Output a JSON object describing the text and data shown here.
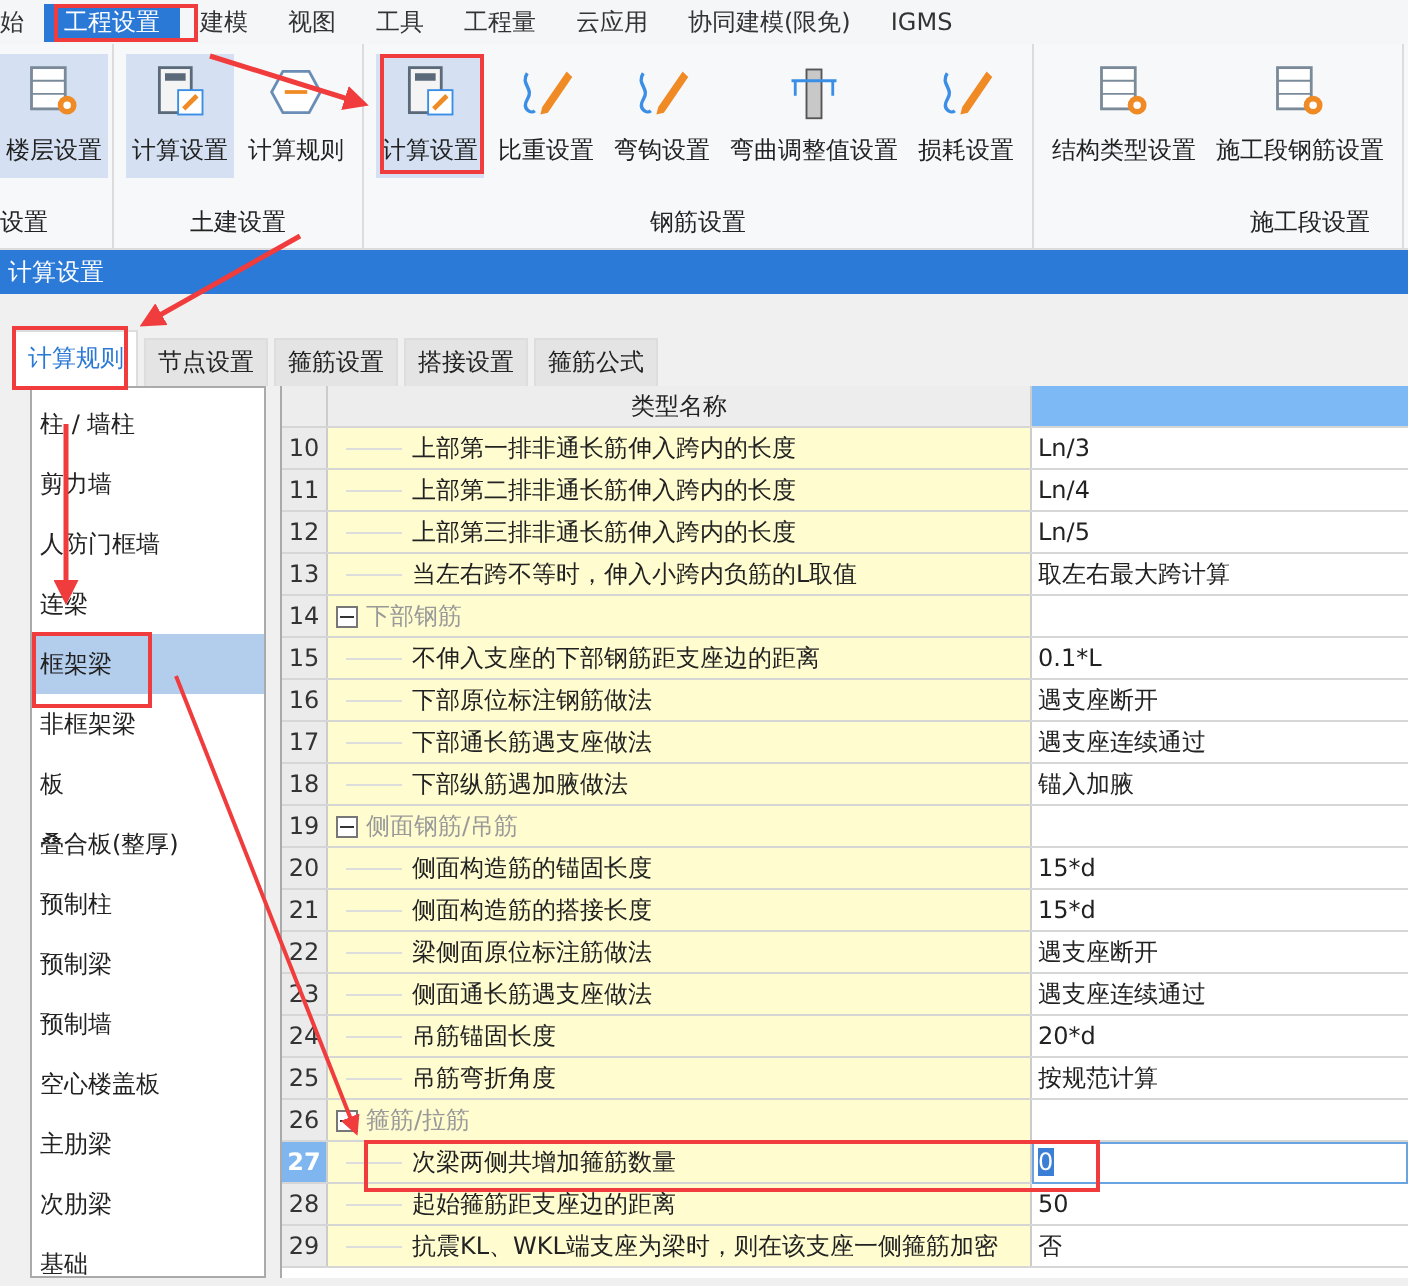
{
  "menu": [
    {
      "label": "始",
      "selected": false
    },
    {
      "label": "工程设置",
      "selected": true
    },
    {
      "label": "建模",
      "selected": false
    },
    {
      "label": "视图",
      "selected": false
    },
    {
      "label": "工具",
      "selected": false
    },
    {
      "label": "工程量",
      "selected": false
    },
    {
      "label": "云应用",
      "selected": false
    },
    {
      "label": "协同建模(限免)",
      "selected": false
    },
    {
      "label": "IGMS",
      "selected": false
    }
  ],
  "ribbon": [
    {
      "title": "设置",
      "buttons": [
        {
          "label": "楼层设置",
          "selected": true
        }
      ]
    },
    {
      "title": "土建设置",
      "buttons": [
        {
          "label": "计算设置",
          "selected": true
        },
        {
          "label": "计算规则",
          "selected": false
        }
      ]
    },
    {
      "title": "钢筋设置",
      "buttons": [
        {
          "label": "计算设置",
          "selected": true
        },
        {
          "label": "比重设置",
          "selected": false
        },
        {
          "label": "弯钩设置",
          "selected": false
        },
        {
          "label": "弯曲调整值设置",
          "selected": false
        },
        {
          "label": "损耗设置",
          "selected": false
        }
      ]
    },
    {
      "title": "施工段设置",
      "buttons": [
        {
          "label": "结构类型设置",
          "selected": false
        },
        {
          "label": "施工段钢筋设置",
          "selected": false
        }
      ]
    }
  ],
  "dialog": {
    "title": "计算设置"
  },
  "tabs": [
    {
      "label": "计算规则",
      "selected": true
    },
    {
      "label": "节点设置",
      "selected": false
    },
    {
      "label": "箍筋设置",
      "selected": false
    },
    {
      "label": "搭接设置",
      "selected": false
    },
    {
      "label": "箍筋公式",
      "selected": false
    }
  ],
  "sidebar": {
    "items": [
      {
        "label": "柱 / 墙柱",
        "selected": false
      },
      {
        "label": "剪力墙",
        "selected": false
      },
      {
        "label": "人防门框墙",
        "selected": false
      },
      {
        "label": "连梁",
        "selected": false
      },
      {
        "label": "框架梁",
        "selected": true
      },
      {
        "label": "非框架梁",
        "selected": false
      },
      {
        "label": "板",
        "selected": false
      },
      {
        "label": "叠合板(整厚)",
        "selected": false
      },
      {
        "label": "预制柱",
        "selected": false
      },
      {
        "label": "预制梁",
        "selected": false
      },
      {
        "label": "预制墙",
        "selected": false
      },
      {
        "label": "空心楼盖板",
        "selected": false
      },
      {
        "label": "主肋梁",
        "selected": false
      },
      {
        "label": "次肋梁",
        "selected": false
      },
      {
        "label": "基础",
        "selected": false
      }
    ]
  },
  "table": {
    "columns": [
      "类型名称"
    ],
    "rows": [
      {
        "kind": "item",
        "no": "10",
        "name": "上部第一排非通长筋伸入跨内的长度",
        "value": "Ln/3",
        "selected": false
      },
      {
        "kind": "item",
        "no": "11",
        "name": "上部第二排非通长筋伸入跨内的长度",
        "value": "Ln/4",
        "selected": false
      },
      {
        "kind": "item",
        "no": "12",
        "name": "上部第三排非通长筋伸入跨内的长度",
        "value": "Ln/5",
        "selected": false
      },
      {
        "kind": "item",
        "no": "13",
        "name": "当左右跨不等时，伸入小跨内负筋的L取值",
        "value": "取左右最大跨计算",
        "selected": false
      },
      {
        "kind": "group",
        "no": "14",
        "name": "下部钢筋",
        "expanded": true,
        "children": [
          {
            "kind": "item",
            "no": "15",
            "name": "不伸入支座的下部钢筋距支座边的距离",
            "value": "0.1*L",
            "selected": false
          },
          {
            "kind": "item",
            "no": "16",
            "name": "下部原位标注钢筋做法",
            "value": "遇支座断开",
            "selected": false
          },
          {
            "kind": "item",
            "no": "17",
            "name": "下部通长筋遇支座做法",
            "value": "遇支座连续通过",
            "selected": false
          },
          {
            "kind": "item",
            "no": "18",
            "name": "下部纵筋遇加腋做法",
            "value": "锚入加腋",
            "selected": false
          }
        ]
      },
      {
        "kind": "group",
        "no": "19",
        "name": "侧面钢筋/吊筋",
        "expanded": true,
        "children": [
          {
            "kind": "item",
            "no": "20",
            "name": "侧面构造筋的锚固长度",
            "value": "15*d",
            "selected": false
          },
          {
            "kind": "item",
            "no": "21",
            "name": "侧面构造筋的搭接长度",
            "value": "15*d",
            "selected": false
          },
          {
            "kind": "item",
            "no": "22",
            "name": "梁侧面原位标注筋做法",
            "value": "遇支座断开",
            "selected": false
          },
          {
            "kind": "item",
            "no": "23",
            "name": "侧面通长筋遇支座做法",
            "value": "遇支座连续通过",
            "selected": false
          },
          {
            "kind": "item",
            "no": "24",
            "name": "吊筋锚固长度",
            "value": "20*d",
            "selected": false
          },
          {
            "kind": "item",
            "no": "25",
            "name": "吊筋弯折角度",
            "value": "按规范计算",
            "selected": false
          }
        ]
      },
      {
        "kind": "group",
        "no": "26",
        "name": "箍筋/拉筋",
        "expanded": true,
        "children": [
          {
            "kind": "item",
            "no": "27",
            "name": "次梁两侧共增加箍筋数量",
            "value": "0",
            "selected": true
          },
          {
            "kind": "item",
            "no": "28",
            "name": "起始箍筋距支座边的距离",
            "value": "50",
            "selected": false
          },
          {
            "kind": "item",
            "no": "29",
            "name": "抗震KL、WKL端支座为梁时，则在该支座一侧箍筋加密",
            "value": "否",
            "selected": false
          }
        ]
      }
    ]
  }
}
